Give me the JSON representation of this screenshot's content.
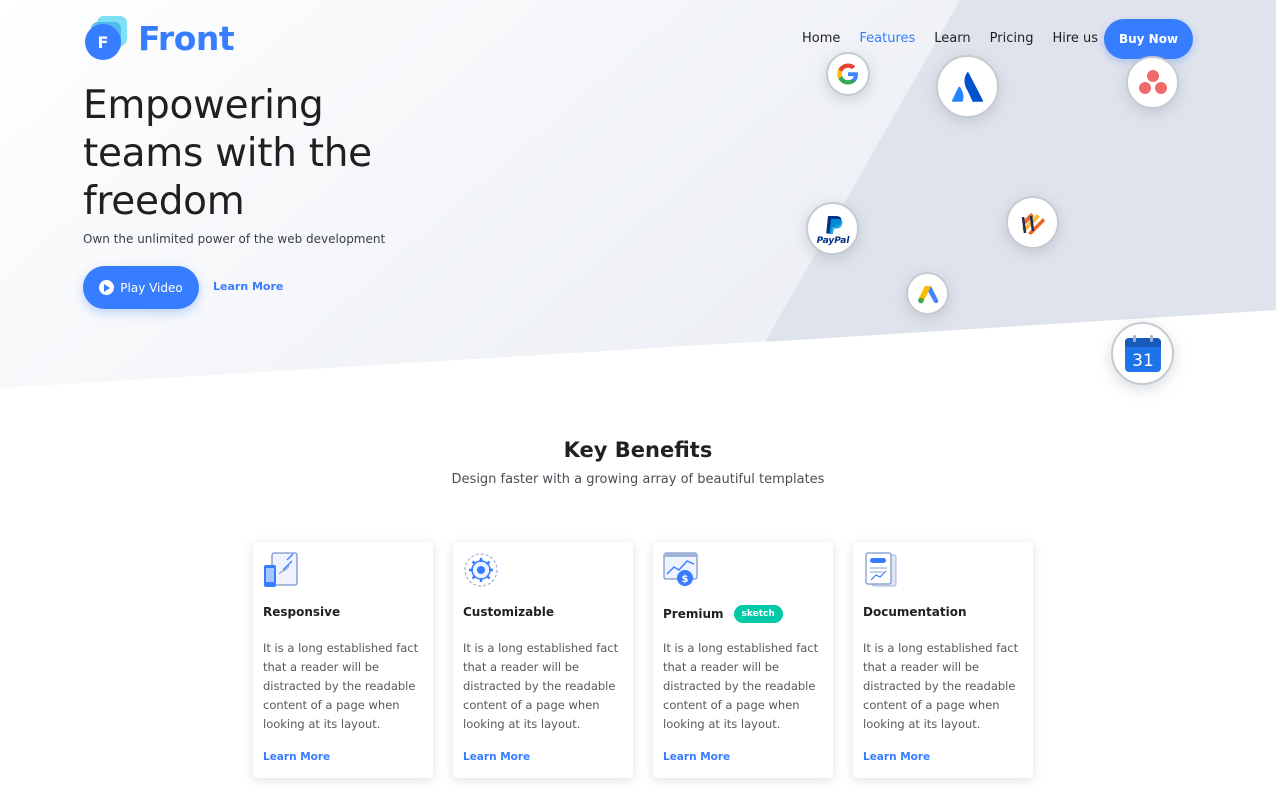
{
  "brand": {
    "name": "Front",
    "logo_letter": "F"
  },
  "nav": {
    "items": [
      {
        "label": "Home",
        "active": false
      },
      {
        "label": "Features",
        "active": true
      },
      {
        "label": "Learn",
        "active": false
      },
      {
        "label": "Pricing",
        "active": false
      },
      {
        "label": "Hire us",
        "active": false
      }
    ],
    "cta_label": "Buy Now"
  },
  "hero": {
    "title": "Empowering teams with the freedom",
    "subtitle": "Own the unlimited power of the web development",
    "play_label": "Play Video",
    "learn_label": "Learn More"
  },
  "integrations": [
    {
      "icon": "google-icon"
    },
    {
      "icon": "atlassian-icon"
    },
    {
      "icon": "asana-icon"
    },
    {
      "icon": "paypal-icon",
      "text": "PayPal"
    },
    {
      "icon": "zeplin-icon"
    },
    {
      "icon": "google-ads-icon"
    },
    {
      "icon": "google-calendar-icon",
      "text": "31"
    }
  ],
  "benefits": {
    "title": "Key Benefits",
    "subtitle": "Design faster with a growing array of beautiful templates",
    "cards": [
      {
        "title": "Responsive",
        "icon": "responsive-devices-icon",
        "badge": "",
        "text": "It is a long established fact that a reader will be distracted by the readable content of a page when looking at its layout.",
        "link": "Learn More"
      },
      {
        "title": "Customizable",
        "icon": "gear-icon",
        "badge": "",
        "text": "It is a long established fact that a reader will be distracted by the readable content of a page when looking at its layout.",
        "link": "Learn More"
      },
      {
        "title": "Premium",
        "icon": "chart-dollar-icon",
        "badge": "sketch",
        "text": "It is a long established fact that a reader will be distracted by the readable content of a page when looking at its layout.",
        "link": "Learn More"
      },
      {
        "title": "Documentation",
        "icon": "document-icon",
        "badge": "",
        "text": "It is a long established fact that a reader will be distracted by the readable content of a page when looking at its layout.",
        "link": "Learn More"
      }
    ]
  },
  "colors": {
    "primary": "#377dff",
    "success": "#00c9a7",
    "dark": "#1e2022",
    "hero_bg": "#e7eaf3"
  }
}
